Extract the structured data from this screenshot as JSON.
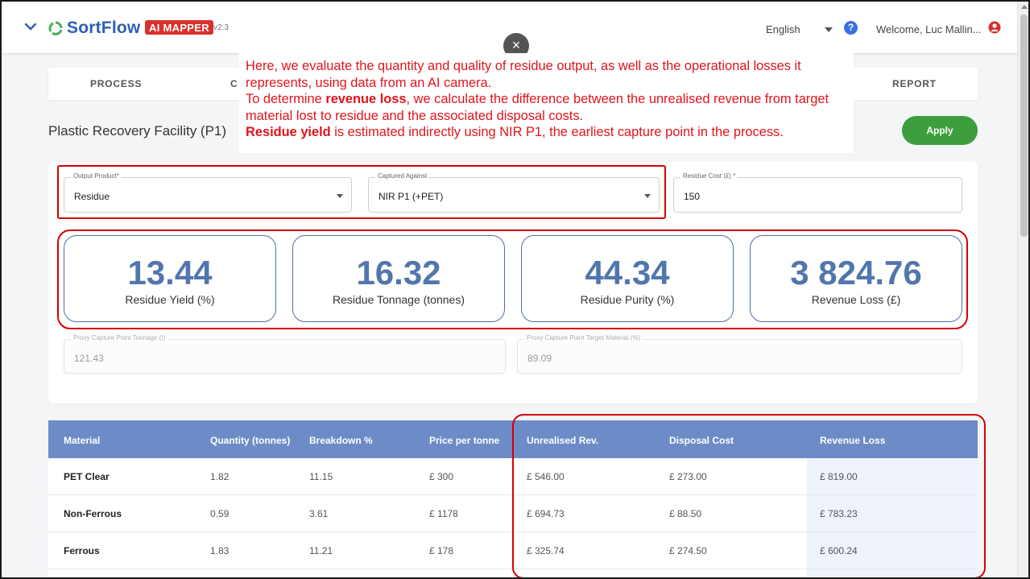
{
  "header": {
    "brand": "SortFlow",
    "badge": "AI MAPPER",
    "version": "v2.3",
    "language": "English",
    "welcome": "Welcome, Luc Mallin...",
    "colors": {
      "brand": "#2f5fb4",
      "badge": "#d9302c",
      "logo": "#4caf50"
    }
  },
  "tabs": [
    {
      "label": "PROCESS"
    },
    {
      "label": "C"
    },
    {
      "label": "REPORT"
    }
  ],
  "page": {
    "title": "Plastic Recovery Facility (P1)",
    "apply_label": "Apply"
  },
  "form": {
    "output_product": {
      "label": "Output Product*",
      "value": "Residue"
    },
    "captured_against": {
      "label": "Captured Against",
      "value": "NIR P1 (+PET)"
    },
    "residue_cost": {
      "label": "Residue Cost (£) *",
      "value": "150"
    },
    "proxy_tonnage": {
      "label": "Proxy Capture Point Tonnage (t)",
      "value": "121.43"
    },
    "proxy_target": {
      "label": "Proxy Capture Point Target Material (%)",
      "value": "89.09"
    }
  },
  "metrics": [
    {
      "value": "13.44",
      "label": "Residue Yield (%)"
    },
    {
      "value": "16.32",
      "label": "Residue Tonnage (tonnes)"
    },
    {
      "value": "44.34",
      "label": "Residue Purity (%)"
    },
    {
      "value": "3 824.76",
      "label": "Revenue Loss (£)"
    }
  ],
  "table": {
    "headers": [
      "Material",
      "Quantity (tonnes)",
      "Breakdown %",
      "Price per tonne",
      "Unrealised Rev.",
      "Disposal Cost",
      "Revenue Loss"
    ],
    "rows": [
      [
        "PET Clear",
        "1.82",
        "11.15",
        "£ 300",
        "£ 546.00",
        "£ 273.00",
        "£ 819.00"
      ],
      [
        "Non-Ferrous",
        "0.59",
        "3.61",
        "£ 1178",
        "£ 694.73",
        "£ 88.50",
        "£ 783.23"
      ],
      [
        "Ferrous",
        "1.83",
        "11.21",
        "£ 178",
        "£ 325.74",
        "£ 274.50",
        "£ 600.24"
      ]
    ]
  },
  "overlay": {
    "close_symbol": "×",
    "line1": "Here, we evaluate the quantity and quality of residue output, as well as the operational losses it represents, using data from an AI camera.",
    "line2_pre": "To determine ",
    "line2_bold": "revenue loss",
    "line2_post": ", we calculate the difference between the unrealised revenue from target material lost to residue and the associated disposal costs.",
    "line3_bold": "Residue yield",
    "line3_post": " is estimated indirectly using NIR P1, the earliest capture point in the process.",
    "text_color": "#e0141c"
  },
  "icons": [
    "chevron-down-icon",
    "recycle-logo-icon",
    "dropdown-caret-icon",
    "help-icon",
    "user-icon",
    "close-icon"
  ]
}
